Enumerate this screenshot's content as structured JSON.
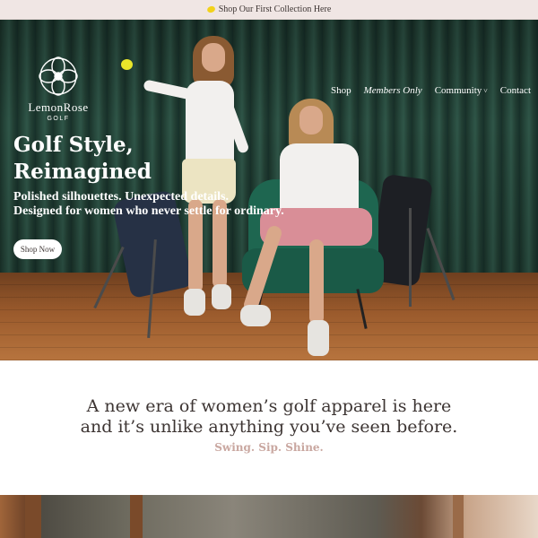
{
  "announcement": {
    "icon": "lemon-icon",
    "text": "Shop Our First Collection Here"
  },
  "logo": {
    "name": "LemonRose",
    "sub": "GOLF"
  },
  "nav": {
    "items": [
      {
        "label": "Shop"
      },
      {
        "label": "Members Only"
      },
      {
        "label": "Community",
        "icon": "chevron-down-icon",
        "chevron": "˅"
      },
      {
        "label": "Contact"
      }
    ]
  },
  "hero": {
    "headline_line1": "Golf Style,",
    "headline_line2": "Reimagined",
    "sub_line1": "Polished silhouettes. Unexpected details.",
    "sub_line2": "Designed for women who never settle for ordinary.",
    "button_label": "Shop Now"
  },
  "intro": {
    "line1": "A new era of women’s golf apparel is here",
    "line2": "and it’s unlike anything you’ve seen before.",
    "tagline": "Swing. Sip. Shine."
  },
  "colors": {
    "announcement_bg": "#f0e6e4",
    "accent_tagline": "#c9a7a0",
    "text_dark": "#3d3533"
  }
}
